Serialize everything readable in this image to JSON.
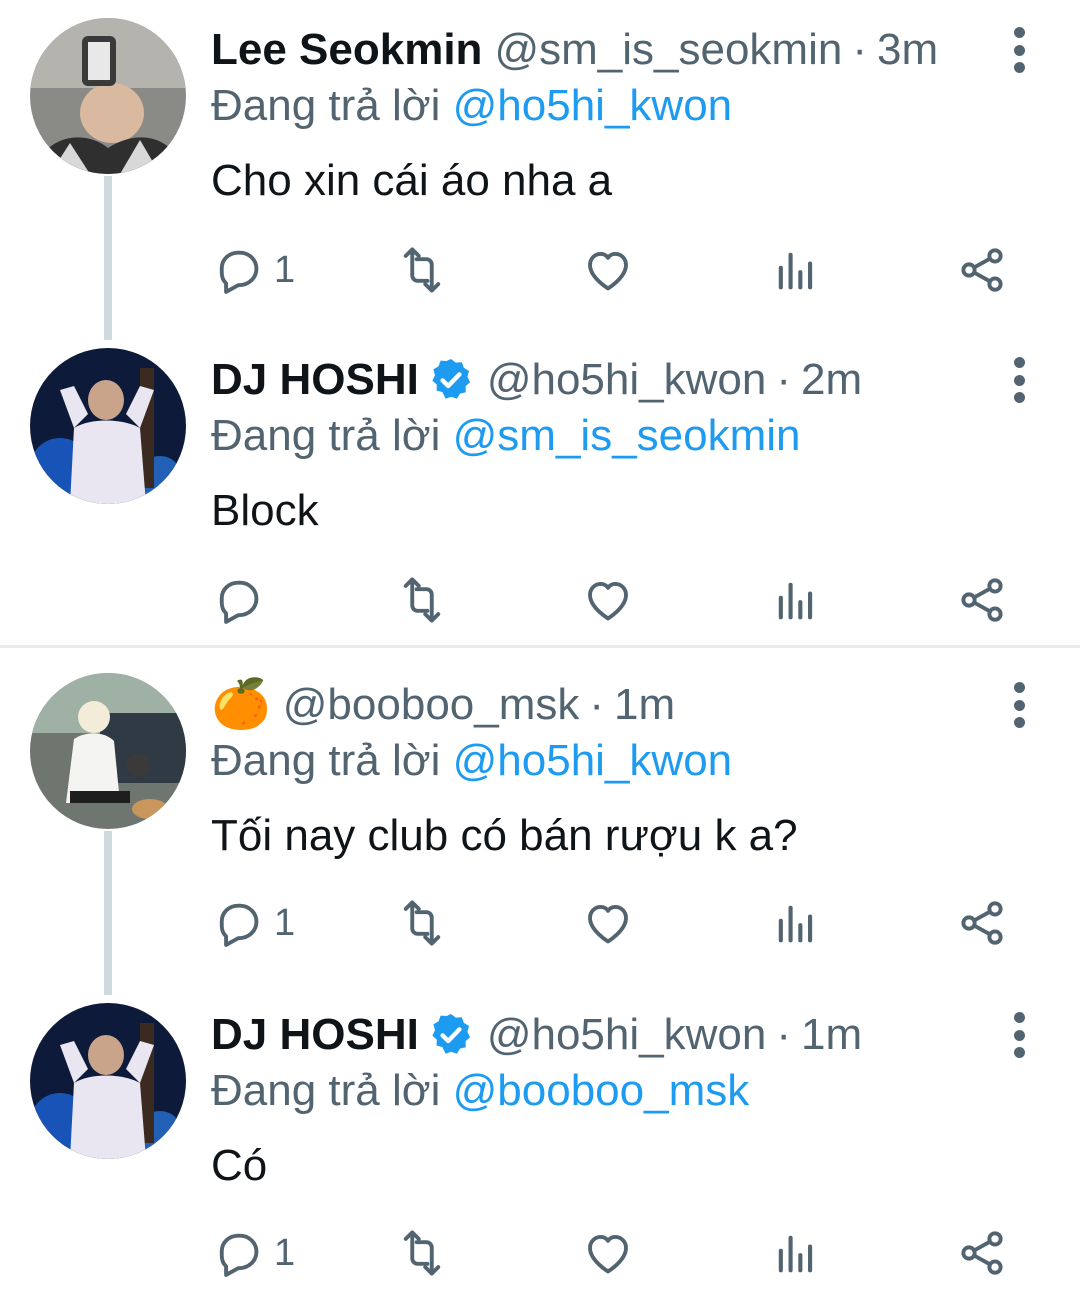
{
  "replying_label": "Đang trả lời",
  "colors": {
    "link": "#1d9bf0",
    "secondary": "#536471",
    "verified": "#1d9bf0"
  },
  "tweets": [
    {
      "name": "Lee Seokmin",
      "handle": "@sm_is_seokmin",
      "separator": "·",
      "time": "3m",
      "reply_to": "@ho5hi_kwon",
      "text": "Cho xin cái áo nha a",
      "reply_count": "1",
      "verified": false,
      "icons": [
        "reply-icon",
        "retweet-icon",
        "like-icon",
        "views-icon",
        "share-icon",
        "more-icon"
      ]
    },
    {
      "name": "DJ HOSHI",
      "handle": "@ho5hi_kwon",
      "separator": "·",
      "time": "2m",
      "reply_to": "@sm_is_seokmin",
      "text": "Block",
      "reply_count": "",
      "verified": true,
      "icons": [
        "reply-icon",
        "retweet-icon",
        "like-icon",
        "views-icon",
        "share-icon",
        "more-icon"
      ]
    },
    {
      "name_emoji": "🍊",
      "handle": "@booboo_msk",
      "separator": "·",
      "time": "1m",
      "reply_to": "@ho5hi_kwon",
      "text": "Tối nay club có bán rượu k a?",
      "reply_count": "1",
      "verified": false,
      "icons": [
        "reply-icon",
        "retweet-icon",
        "like-icon",
        "views-icon",
        "share-icon",
        "more-icon"
      ]
    },
    {
      "name": "DJ HOSHI",
      "handle": "@ho5hi_kwon",
      "separator": "·",
      "time": "1m",
      "reply_to": "@booboo_msk",
      "text": "Có",
      "reply_count": "1",
      "verified": true,
      "icons": [
        "reply-icon",
        "retweet-icon",
        "like-icon",
        "views-icon",
        "share-icon",
        "more-icon"
      ]
    }
  ]
}
